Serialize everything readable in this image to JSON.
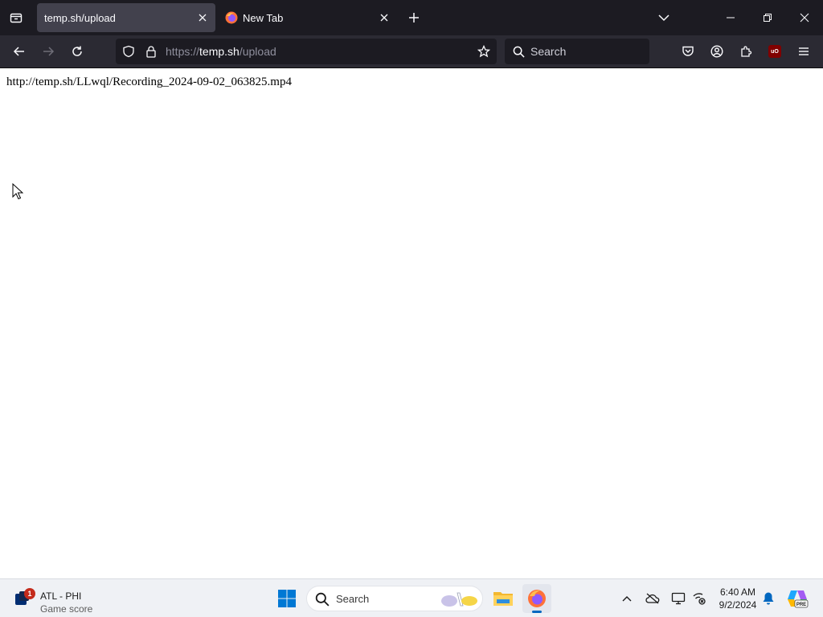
{
  "browser": {
    "tabs": [
      {
        "title": "temp.sh/upload",
        "active": true
      },
      {
        "title": "New Tab",
        "active": false
      }
    ],
    "urlbar": {
      "scheme": "https://",
      "host": "temp.sh",
      "path": "/upload"
    },
    "searchbar": {
      "placeholder": "Search"
    },
    "toolbar_icons": [
      "tab-list-icon",
      "new-tab-plus-icon",
      "list-all-tabs-icon",
      "minimize-icon",
      "restore-icon",
      "close-icon",
      "back-arrow-icon",
      "forward-arrow-icon",
      "reload-icon",
      "tracking-shield-icon",
      "lock-icon",
      "bookmark-star-icon",
      "search-icon",
      "pocket-icon",
      "account-icon",
      "extensions-icon",
      "ublock-icon",
      "hamburger-menu-icon"
    ],
    "extension_badge": "uO"
  },
  "page": {
    "result_text": "http://temp.sh/LLwql/Recording_2024-09-02_063825.mp4"
  },
  "taskbar": {
    "widget": {
      "title": "ATL - PHI",
      "subtitle": "Game score",
      "badge_count": "1"
    },
    "search_placeholder": "Search",
    "clock": {
      "time": "6:40 AM",
      "date": "9/2/2024"
    },
    "copilot_badge": "PRE",
    "colors": {
      "accent": "#0067c0",
      "notification_badge": "#c42b1c"
    }
  }
}
